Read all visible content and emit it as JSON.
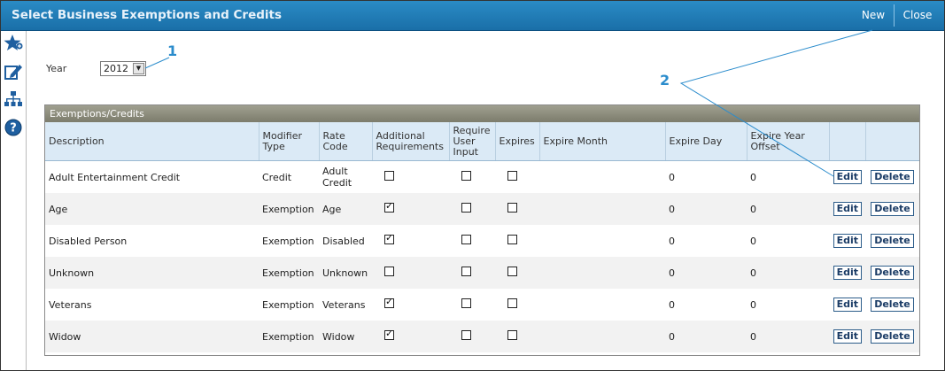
{
  "window": {
    "title": "Select Business Exemptions and Credits",
    "new_label": "New",
    "close_label": "Close"
  },
  "sidebar": [
    "favorites-icon",
    "edit-icon",
    "hierarchy-icon",
    "help-icon"
  ],
  "year": {
    "label": "Year",
    "value": "2012"
  },
  "callouts": {
    "one": "1",
    "two": "2"
  },
  "grid": {
    "caption": "Exemptions/Credits",
    "columns": {
      "description": "Description",
      "modifier_type": "Modifier Type",
      "rate_code": "Rate Code",
      "additional": "Additional Requirements",
      "require_input": "Require User Input",
      "expires": "Expires",
      "expire_month": "Expire Month",
      "expire_day": "Expire Day",
      "expire_year_offset": "Expire Year Offset"
    },
    "edit_label": "Edit",
    "delete_label": "Delete",
    "rows": [
      {
        "description": "Adult Entertainment Credit",
        "modifier_type": "Credit",
        "rate_code": "Adult Credit",
        "additional": false,
        "require_input": false,
        "expires": false,
        "expire_month": "",
        "expire_day": "0",
        "expire_year_offset": "0"
      },
      {
        "description": "Age",
        "modifier_type": "Exemption",
        "rate_code": "Age",
        "additional": true,
        "require_input": false,
        "expires": false,
        "expire_month": "",
        "expire_day": "0",
        "expire_year_offset": "0"
      },
      {
        "description": "Disabled Person",
        "modifier_type": "Exemption",
        "rate_code": "Disabled",
        "additional": true,
        "require_input": false,
        "expires": false,
        "expire_month": "",
        "expire_day": "0",
        "expire_year_offset": "0"
      },
      {
        "description": "Unknown",
        "modifier_type": "Exemption",
        "rate_code": "Unknown",
        "additional": false,
        "require_input": false,
        "expires": false,
        "expire_month": "",
        "expire_day": "0",
        "expire_year_offset": "0"
      },
      {
        "description": "Veterans",
        "modifier_type": "Exemption",
        "rate_code": "Veterans",
        "additional": true,
        "require_input": false,
        "expires": false,
        "expire_month": "",
        "expire_day": "0",
        "expire_year_offset": "0"
      },
      {
        "description": "Widow",
        "modifier_type": "Exemption",
        "rate_code": "Widow",
        "additional": true,
        "require_input": false,
        "expires": false,
        "expire_month": "",
        "expire_day": "0",
        "expire_year_offset": "0"
      }
    ]
  }
}
